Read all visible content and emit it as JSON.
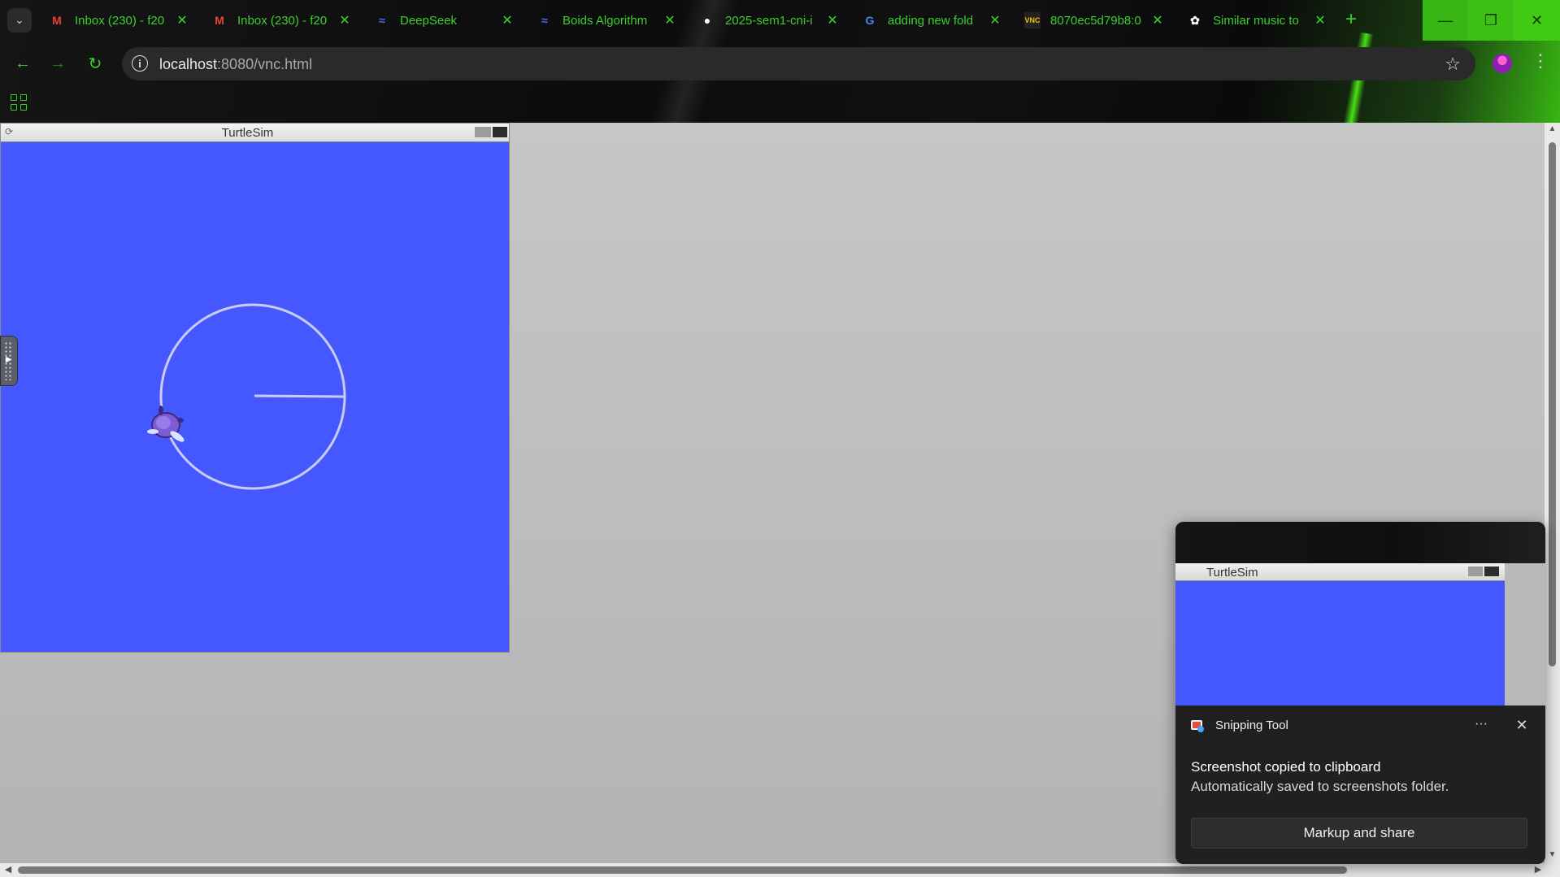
{
  "browser": {
    "tabs": [
      {
        "label": "Inbox (230) - f20",
        "favicon": "gmail-icon",
        "favicon_color": "#ea4335"
      },
      {
        "label": "Inbox (230) - f20",
        "favicon": "gmail-icon",
        "favicon_color": "#ea4335"
      },
      {
        "label": "DeepSeek",
        "favicon": "deepseek-icon",
        "favicon_color": "#4d6bfe"
      },
      {
        "label": "Boids Algorithm",
        "favicon": "deepseek-icon",
        "favicon_color": "#4d6bfe"
      },
      {
        "label": "2025-sem1-cni-i",
        "favicon": "github-icon",
        "favicon_color": "#ffffff"
      },
      {
        "label": "adding new fold",
        "favicon": "google-icon",
        "favicon_color": "#4285f4"
      },
      {
        "label": "8070ec5d79b8:0",
        "favicon": "vnc-icon",
        "favicon_color": "#f2c200"
      },
      {
        "label": "Similar music to",
        "favicon": "chatgpt-icon",
        "favicon_color": "#ffffff"
      }
    ],
    "url_host": "localhost",
    "url_path": ":8080/vnc.html",
    "accent_color": "#3ccf2f"
  },
  "turtlesim": {
    "title": "TurtleSim",
    "background_color": "#4558ff"
  },
  "toast": {
    "app_name": "Snipping Tool",
    "preview_title": "TurtleSim",
    "message_title": "Screenshot copied to clipboard",
    "message_body": "Automatically saved to screenshots folder.",
    "action_label": "Markup and share",
    "more_label": "···",
    "close_label": "✕"
  }
}
